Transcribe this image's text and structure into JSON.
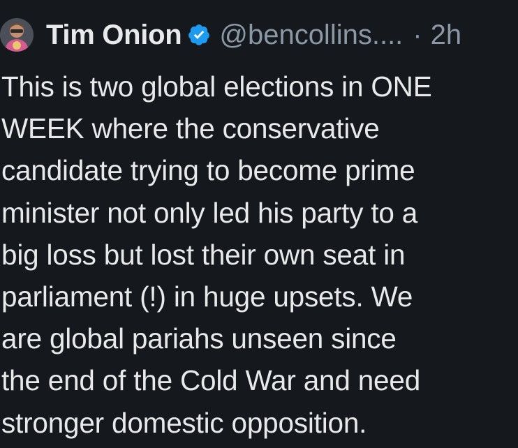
{
  "tweet": {
    "display_name": "Tim Onion",
    "handle": "@bencollins....",
    "separator": "·",
    "time": "2h",
    "verified": true,
    "avatar_icon": "profile-avatar",
    "verified_icon": "verified-badge-icon",
    "colors": {
      "background": "#15181d",
      "text": "#e7e9ea",
      "muted": "#8b98a5",
      "verified": "#1d9bf0"
    },
    "text_lines": [
      "This is two global elections in ONE",
      "WEEK where the conservative",
      "candidate trying to become prime",
      "minister not only led his party to a",
      "big loss but lost their own seat in",
      "parliament (!) in huge upsets. We",
      "are global pariahs unseen since",
      "the end of the Cold War and need",
      "stronger domestic opposition."
    ]
  }
}
